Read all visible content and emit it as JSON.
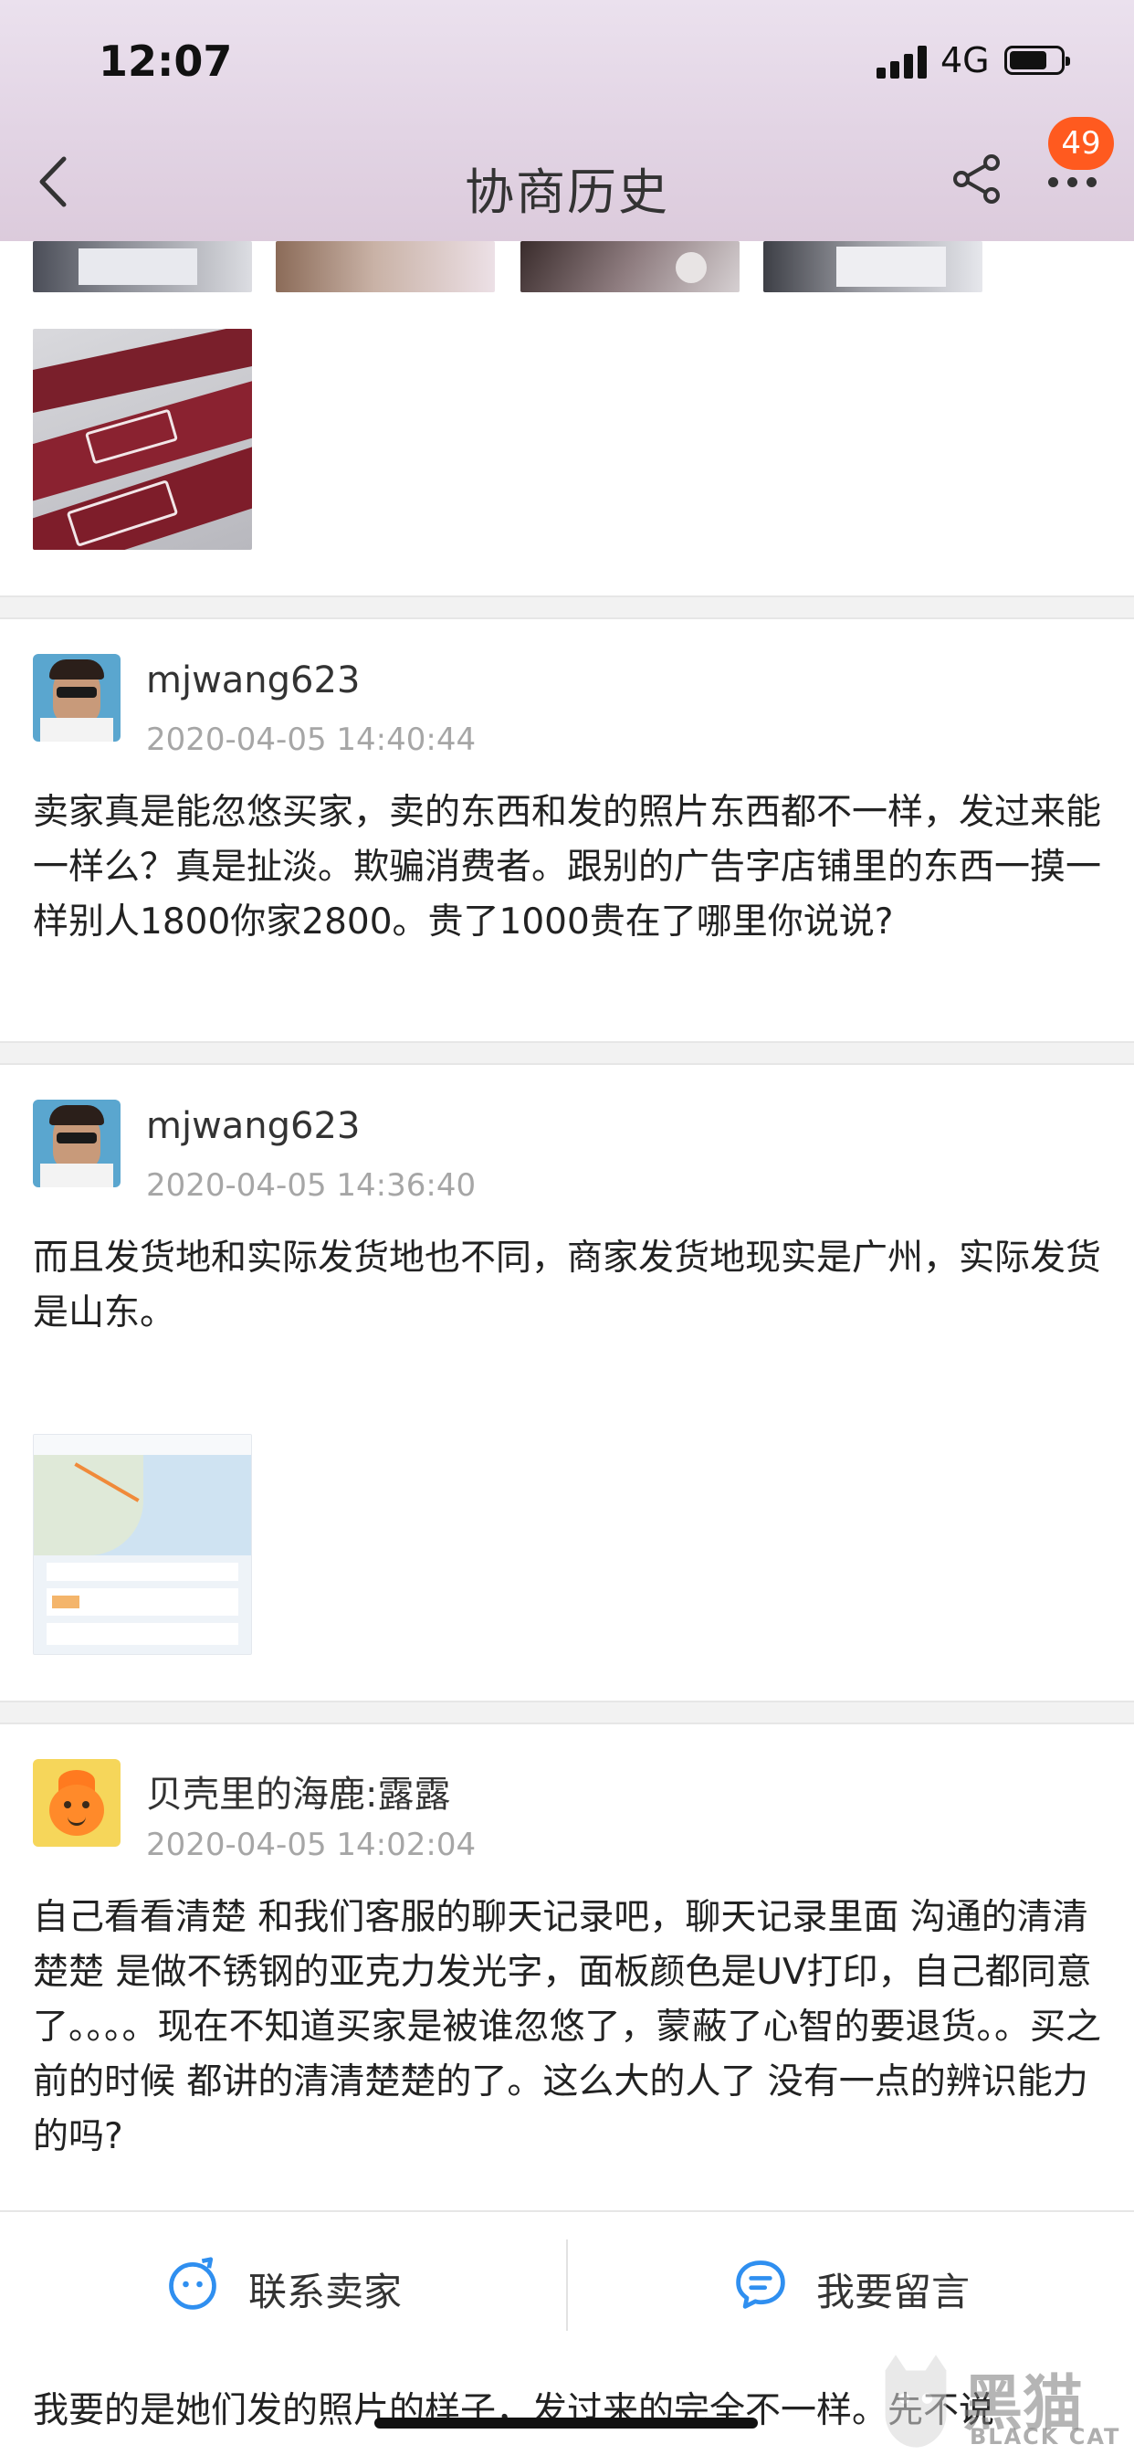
{
  "status_bar": {
    "time": "12:07",
    "network": "4G"
  },
  "header": {
    "title": "协商历史",
    "badge_count": "49"
  },
  "posts": [
    {
      "username": "mjwang623",
      "time": "2020-04-05 14:40:44",
      "text": "卖家真是能忽悠买家，卖的东西和发的照片东西都不一样，发过来能一样么？真是扯淡。欺骗消费者。跟别的广告字店铺里的东西一摸一样别人1800你家2800。贵了1000贵在了哪里你说说?"
    },
    {
      "username": "mjwang623",
      "time": "2020-04-05 14:36:40",
      "text": "而且发货地和实际发货地也不同，商家发货地现实是广州，实际发货是山东。"
    },
    {
      "username": "贝壳里的海鹿:露露",
      "time": "2020-04-05 14:02:04",
      "text": "自己看看清楚 和我们客服的聊天记录吧，聊天记录里面 沟通的清清楚楚  是做不锈钢的亚克力发光字，面板颜色是UV打印，自己都同意了。。。。现在不知道买家是被谁忽悠了，蒙蔽了心智的要退货。。买之前的时候 都讲的清清楚楚的了。这么大的人了  没有一点的辨识能力的吗?"
    }
  ],
  "bottom_bar": {
    "contact_seller": "联系卖家",
    "leave_message": "我要留言"
  },
  "partial_text": "我要的是她们发的照片的样子，发过来的完全不一样。先不说",
  "watermark": {
    "text_cn": "黑猫",
    "text_en": "BLACK CAT"
  },
  "colors": {
    "badge": "#ff5a1f",
    "accent_blue": "#2f8ff0",
    "timestamp": "#a6a6a6"
  }
}
